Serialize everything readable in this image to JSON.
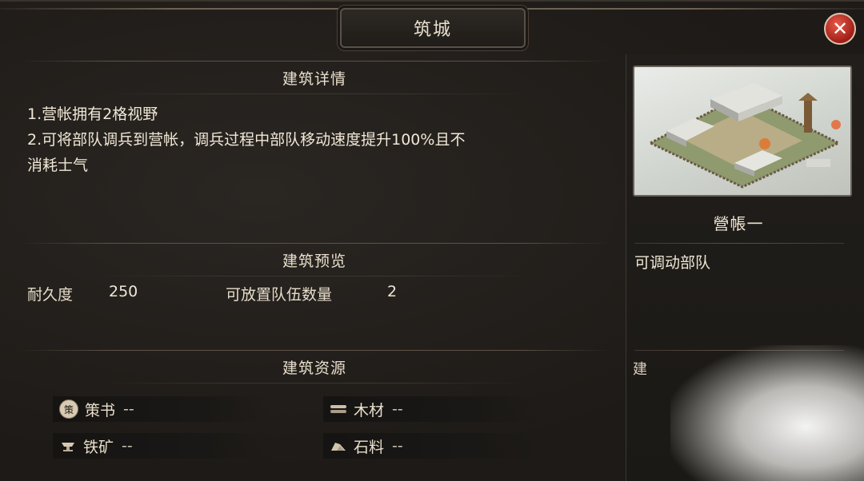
{
  "window": {
    "title": "筑城",
    "close_glyph": "✕"
  },
  "details": {
    "header": "建筑详情",
    "lines": [
      "1.营帐拥有2格视野",
      "2.可将部队调兵到营帐，调兵过程中部队移动速度提升100%且不",
      "消耗士气"
    ]
  },
  "preview": {
    "header": "建筑预览",
    "durability_label": "耐久度",
    "durability_value": "250",
    "slots_label": "可放置队伍数量",
    "slots_value": "2"
  },
  "resources": {
    "header": "建筑资源",
    "items": [
      {
        "icon": "strategy-book-icon",
        "icon_glyph": "策",
        "name": "策书",
        "value": "--"
      },
      {
        "icon": "wood-icon",
        "name": "木材",
        "value": "--"
      },
      {
        "icon": "iron-ore-icon",
        "name": "铁矿",
        "value": "--"
      },
      {
        "icon": "stone-icon",
        "name": "石料",
        "value": "--"
      }
    ]
  },
  "side": {
    "building_name": "營帳一",
    "description": "可调动部队",
    "bottom_text": "建"
  },
  "colors": {
    "background": "#1e1b18",
    "text": "#e6dccb",
    "close_red": "#c0281f",
    "panel_border": "#5a5046"
  }
}
